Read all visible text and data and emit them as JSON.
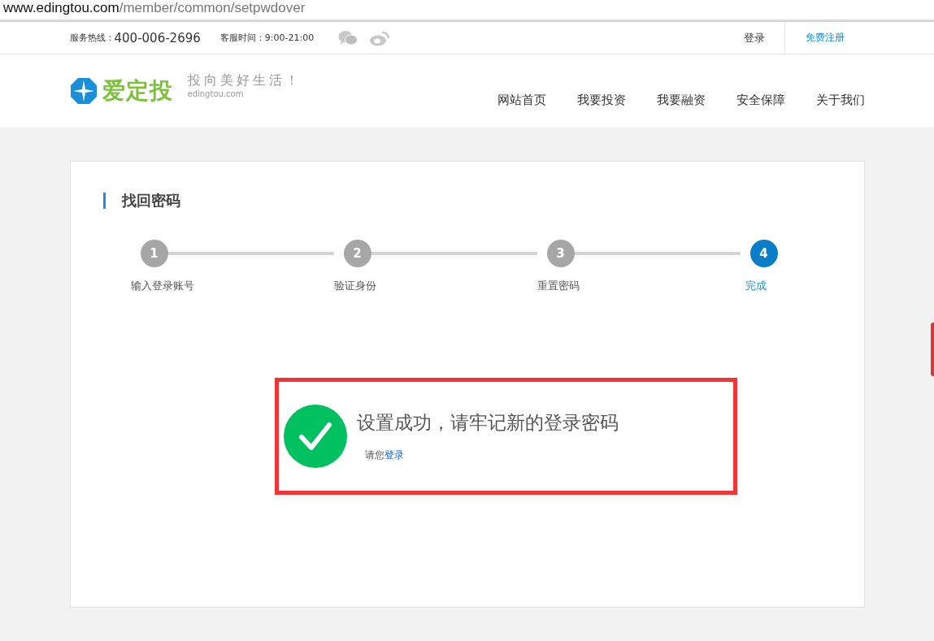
{
  "address_bar": {
    "host": "www.edingtou.com",
    "path": "/member/common/setpwdover"
  },
  "top_bar": {
    "hotline_label": "服务热线：",
    "hotline": "400-006-2696",
    "hours_label": "客服时间：",
    "hours": "9:00-21:00",
    "login": "登录",
    "register": "免费注册"
  },
  "header": {
    "logo_text": "爱定投",
    "slogan": "投向美好生活！",
    "domain": "edingtou.com",
    "nav": [
      "网站首页",
      "我要投资",
      "我要融资",
      "安全保障",
      "关于我们"
    ]
  },
  "card": {
    "title": "找回密码",
    "steps": [
      {
        "number": "1",
        "label": "输入登录账号",
        "selected": false
      },
      {
        "number": "2",
        "label": "验证身份",
        "selected": false
      },
      {
        "number": "3",
        "label": "重置密码",
        "selected": false
      },
      {
        "number": "4",
        "label": "完成",
        "selected": true
      }
    ],
    "message": "设置成功，请牢记新的登录密码",
    "prompt": "请您",
    "login_link": "登录"
  }
}
